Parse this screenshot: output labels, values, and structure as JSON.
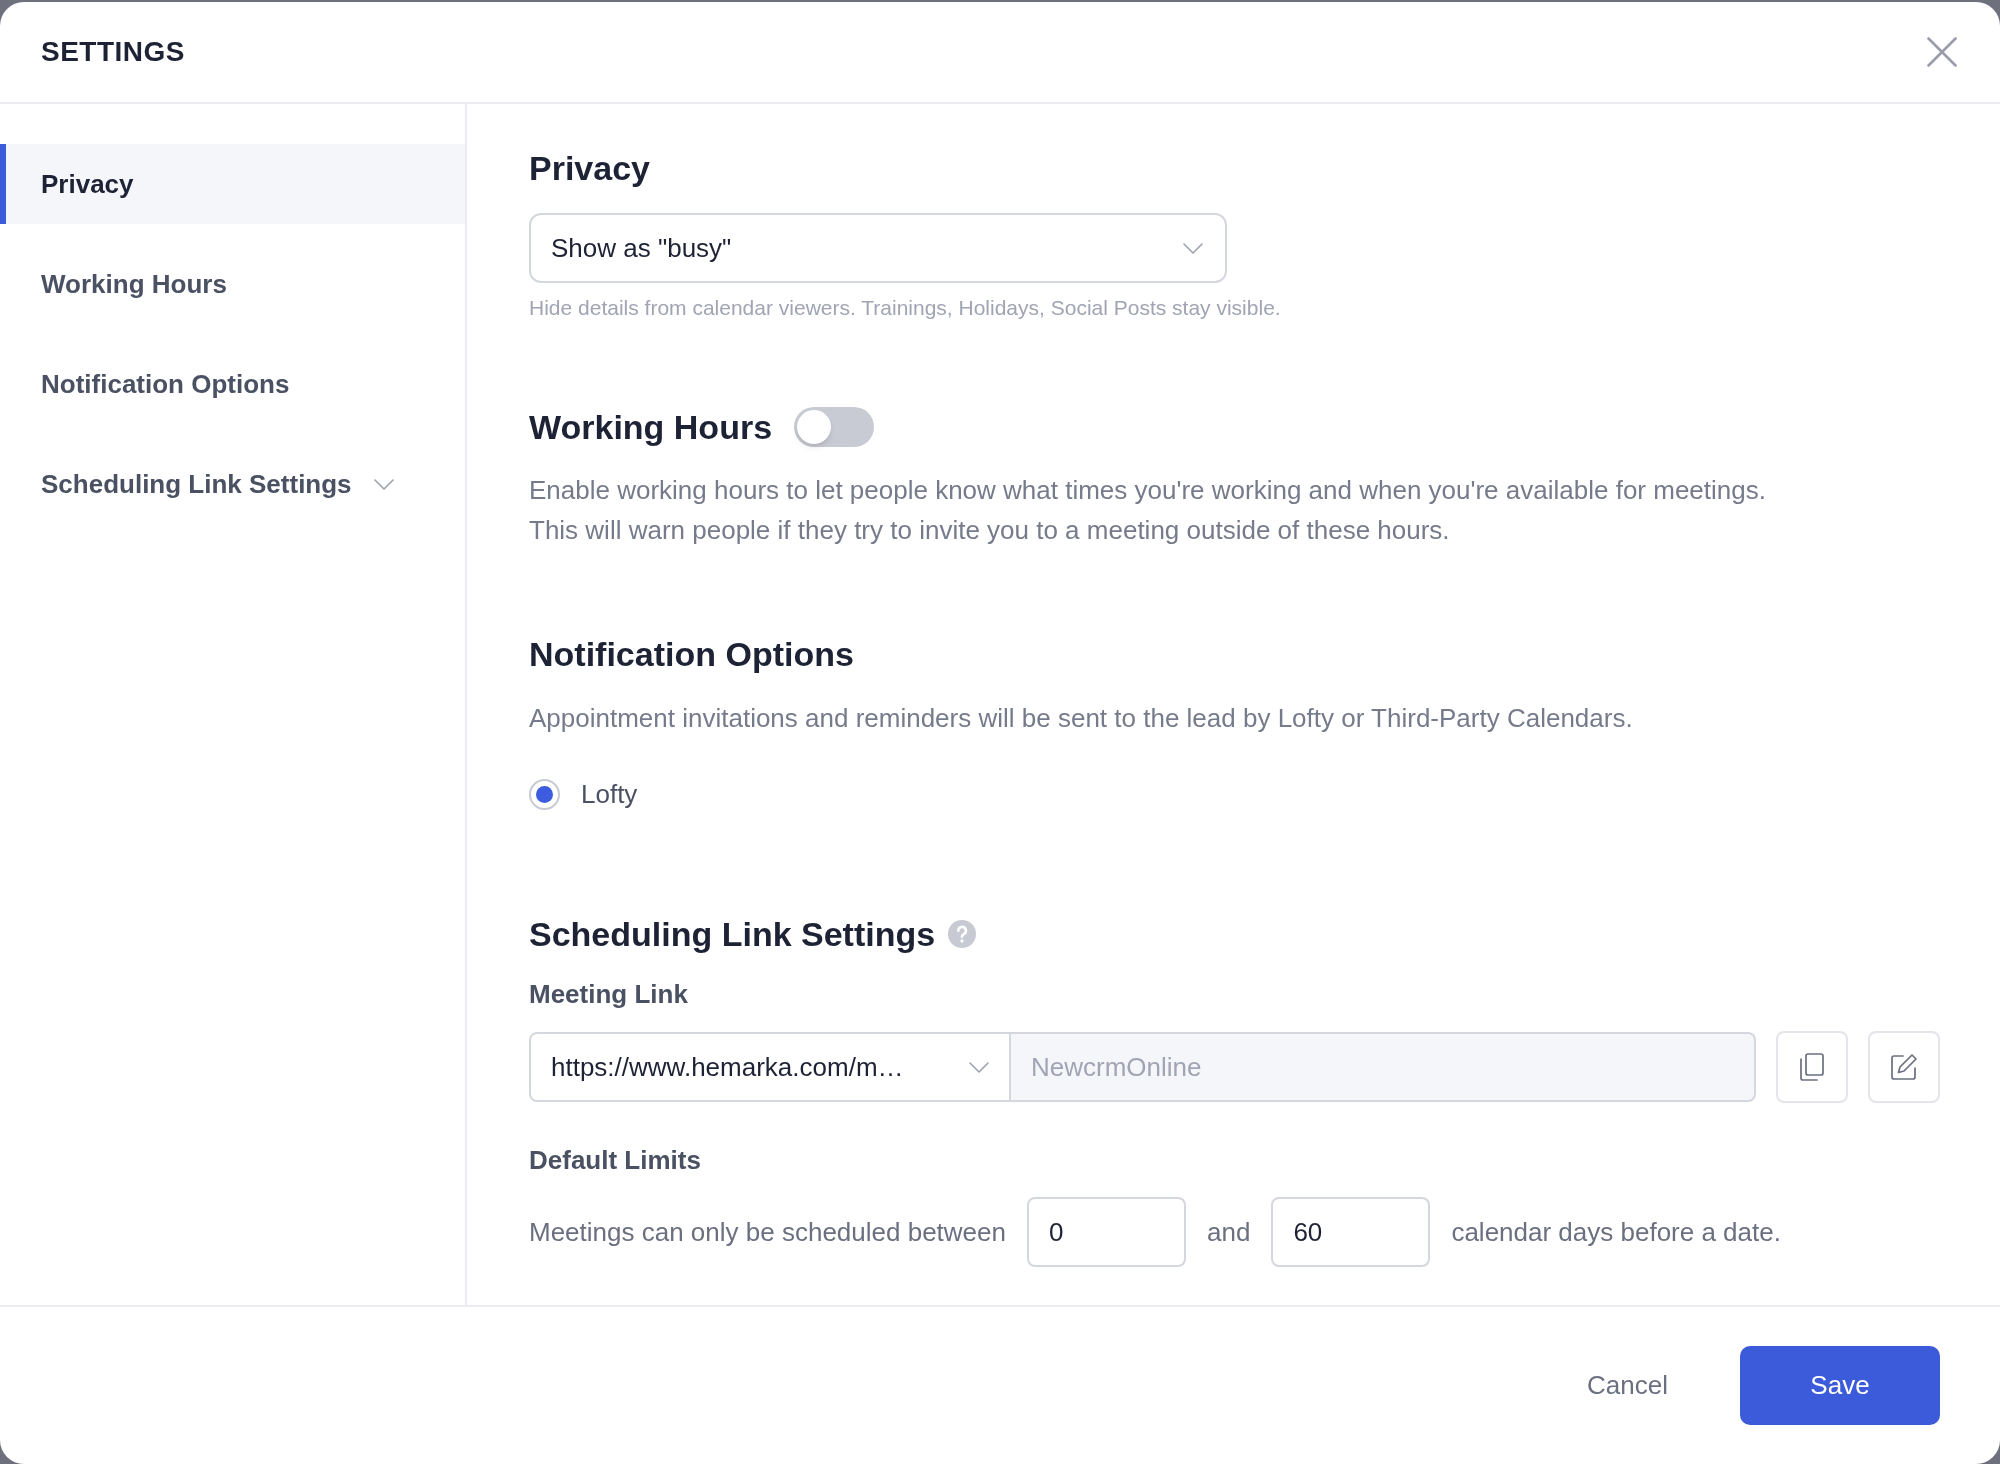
{
  "dialog": {
    "title": "SETTINGS"
  },
  "sidebar": {
    "items": [
      {
        "label": "Privacy",
        "selected": true,
        "kind": "link"
      },
      {
        "label": "Working Hours",
        "selected": false,
        "kind": "link"
      },
      {
        "label": "Notification Options",
        "selected": false,
        "kind": "link"
      },
      {
        "label": "Scheduling Link Settings",
        "selected": false,
        "kind": "group",
        "expanded": false
      }
    ]
  },
  "privacy": {
    "heading": "Privacy",
    "select": {
      "value": "Show as \"busy\""
    },
    "hint": "Hide details from calendar viewers. Trainings, Holidays, Social Posts stay visible."
  },
  "working_hours": {
    "heading": "Working Hours",
    "toggle": {
      "on": false
    },
    "description": "Enable working hours to let people know what times you're working and when you're available for meetings. This will warn people if they try to invite you to a meeting outside of these hours."
  },
  "notification_options": {
    "heading": "Notification Options",
    "description": "Appointment invitations and reminders will be sent to the lead by Lofty or Third-Party Calendars.",
    "options": [
      {
        "label": "Lofty",
        "selected": true
      }
    ]
  },
  "scheduling_link_settings": {
    "heading": "Scheduling Link Settings",
    "meeting_link": {
      "label": "Meeting Link",
      "domain": "https://www.hemarka.com/m…",
      "slug": {
        "value": "NewcrmOnline",
        "disabled": true
      }
    },
    "default_limits": {
      "label": "Default Limits",
      "text_before": "Meetings can only be scheduled between",
      "min": "0",
      "text_between": "and",
      "max": "60",
      "text_after": "calendar days before a date."
    }
  },
  "footer": {
    "buttons": [
      {
        "label": "Cancel",
        "kind": "secondary"
      },
      {
        "label": "Save",
        "kind": "primary"
      }
    ]
  }
}
